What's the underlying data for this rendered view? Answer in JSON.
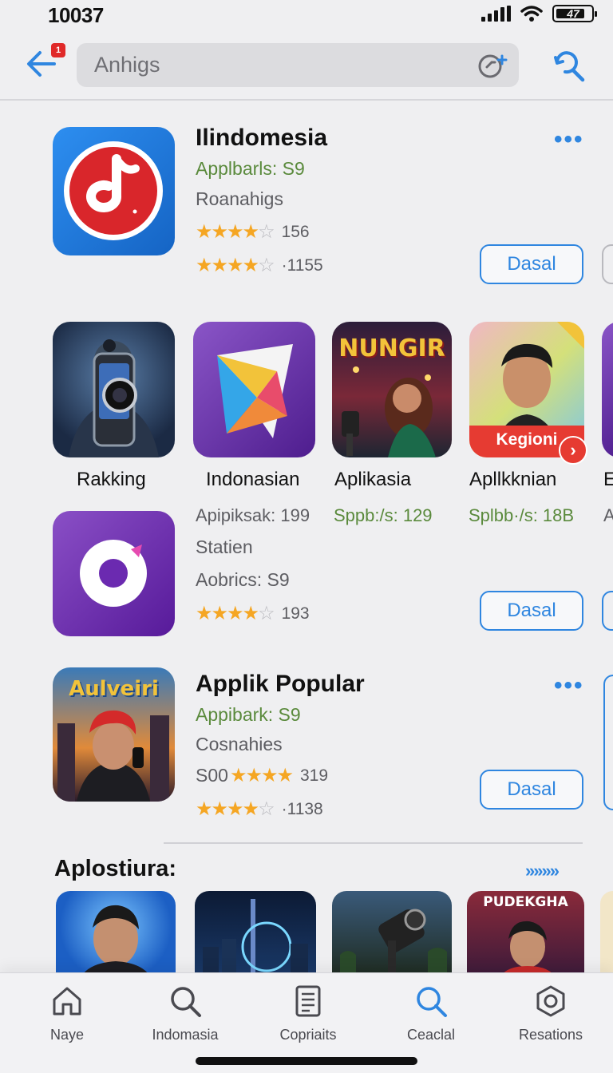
{
  "status_bar": {
    "time": "10037",
    "battery": "47"
  },
  "header": {
    "notification_badge": "1",
    "search": {
      "value": "Anhigs"
    }
  },
  "featured_app": {
    "title": "Ilindomesia",
    "subtitle_green": "Applbarls: S9",
    "category": "Roanahigs",
    "rating1": {
      "count": "156",
      "stars": 4
    },
    "rating2": {
      "count": "·1155",
      "stars": 4
    },
    "button": "Dasal"
  },
  "app_grid": [
    {
      "label": "Rakking",
      "sub": ""
    },
    {
      "label": "Indonasian",
      "sub": "Apipiksak: 199"
    },
    {
      "label": "Aplikasia",
      "sub": "Sppb:/s: 129",
      "banner": "NUNGIR"
    },
    {
      "label": "Apllkknian",
      "sub": "Splbb·/s: 18B",
      "ribbon": "Kegioni"
    },
    {
      "label": "E",
      "sub": "A"
    }
  ],
  "second_app": {
    "line1": "Statien",
    "line2": "Aobrics: S9",
    "rating": {
      "count": "193",
      "stars": 4
    },
    "button": "Dasal"
  },
  "popular_app": {
    "icon_text": "Aulveiri",
    "title": "Applik Popular",
    "subtitle_green": "Appibark: S9",
    "category": "Cosnahies",
    "rating1": {
      "prefix": "S00",
      "count": "319",
      "stars": 4
    },
    "rating2": {
      "count": "·1138",
      "stars": 4
    },
    "button": "Dasal"
  },
  "section": {
    "title": "Aplostiura:",
    "see_more": "»»»»",
    "thumb_text": "PUDEKGHA"
  },
  "tabbar": {
    "tabs": [
      {
        "label": "Naye",
        "icon": "home-icon"
      },
      {
        "label": "Indomasia",
        "icon": "search-icon"
      },
      {
        "label": "Copriaits",
        "icon": "document-icon"
      },
      {
        "label": "Ceaclal",
        "icon": "search-icon"
      },
      {
        "label": "Resations",
        "icon": "hexagon-icon"
      }
    ]
  },
  "colors": {
    "accent": "#2f86e0",
    "star": "#f5a623",
    "green": "#5a8a3c",
    "badge": "#e02929"
  }
}
